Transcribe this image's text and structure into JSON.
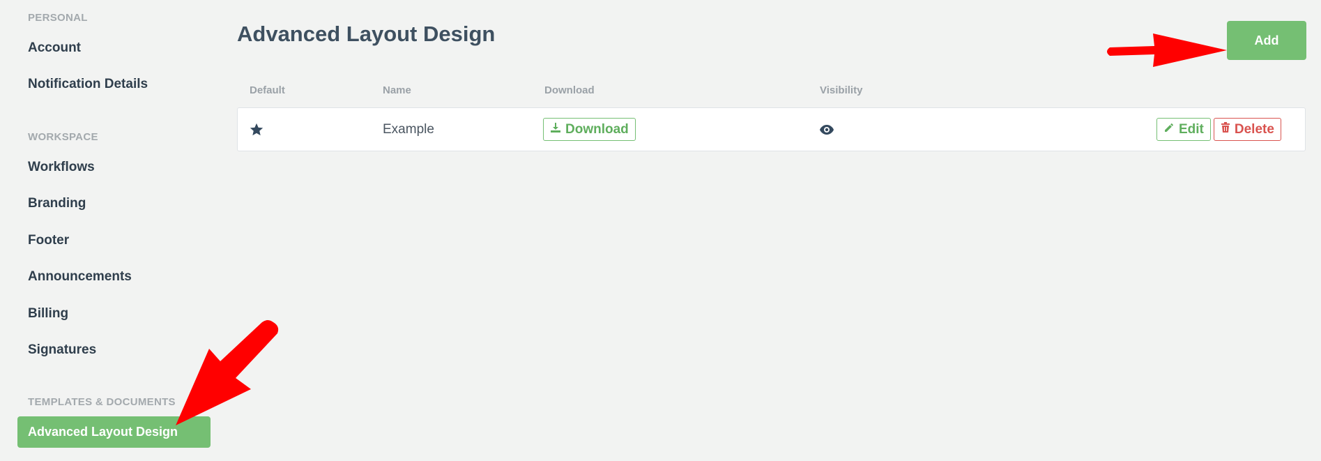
{
  "sidebar": {
    "sections": [
      {
        "title": "PERSONAL",
        "items": [
          "Account",
          "Notification Details"
        ]
      },
      {
        "title": "WORKSPACE",
        "items": [
          "Workflows",
          "Branding",
          "Footer",
          "Announcements",
          "Billing",
          "Signatures"
        ]
      },
      {
        "title": "TEMPLATES & DOCUMENTS",
        "items": [
          "Advanced Layout Design"
        ]
      }
    ],
    "active_item": "Advanced Layout Design"
  },
  "main": {
    "title": "Advanced Layout Design",
    "add_label": "Add",
    "columns": [
      "Default",
      "Name",
      "Download",
      "Visibility"
    ],
    "rows": [
      {
        "default_icon": "star-icon",
        "name": "Example",
        "download_label": "Download",
        "visibility_icon": "eye-icon",
        "edit_label": "Edit",
        "delete_label": "Delete"
      }
    ]
  },
  "colors": {
    "accent": "#75bf73",
    "danger": "#d9534f",
    "annotation_arrow": "#ff0000",
    "background": "#f2f3f2"
  }
}
